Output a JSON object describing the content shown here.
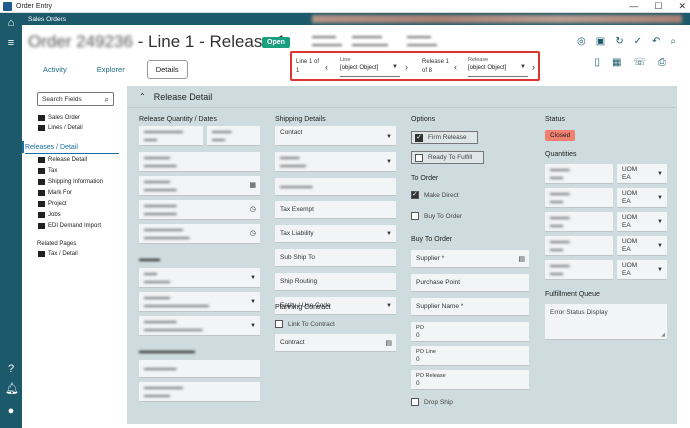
{
  "window": {
    "title": "Order Entry",
    "minimize": "—",
    "maximize": "☐",
    "close": "✕"
  },
  "breadcrumb": "Sales Orders",
  "header": {
    "order_label": "Order",
    "order_number": "249236",
    "line_release": " - Line 1 - Release 1",
    "status": "Open"
  },
  "tabs": [
    {
      "label": "Activity"
    },
    {
      "label": "Explorer"
    },
    {
      "label": "Details"
    }
  ],
  "nav": {
    "line_of_prefix": "Line 1 of",
    "line_of_count": "1",
    "line_caption": "Line",
    "line_value": "[object Object]",
    "release_of_prefix": "Release 1",
    "release_of_count": "of 8",
    "release_caption": "Release",
    "release_value": "[object Object]"
  },
  "sidebar": {
    "search_placeholder": "Search Fields",
    "items": [
      {
        "label": "Sales Order"
      },
      {
        "label": "Lines / Detail"
      }
    ],
    "section": "Releases / Detail",
    "sub_items": [
      {
        "label": "Release Detail"
      },
      {
        "label": "Tax"
      },
      {
        "label": "Shipping Information"
      },
      {
        "label": "Mark For"
      },
      {
        "label": "Project"
      },
      {
        "label": "Jobs"
      },
      {
        "label": "EDI Demand Import"
      }
    ],
    "related_title": "Related Pages",
    "related_items": [
      {
        "label": "Tax / Detail"
      }
    ]
  },
  "panel": {
    "title": "Release Detail",
    "release_qty_title": "Release Quantity / Dates",
    "shipping_title": "Shipping Details",
    "shipping": {
      "contact": "Contact",
      "tax_exempt": "Tax Exempt",
      "tax_liability": "Tax Liability",
      "sub_ship_to": "Sub Ship To",
      "ship_routing": "Ship Routing",
      "entity_use_code": "Entity / Use Code"
    },
    "planning_title": "Planning Contract",
    "link_to_contract": "Link To Contract",
    "contract": "Contract",
    "options_title": "Options",
    "firm_release": "Firm Release",
    "ready_to_fulfill": "Ready To Fulfill",
    "to_order_title": "To Order",
    "make_direct": "Make Direct",
    "buy_to_order": "Buy To Order",
    "buy_to_order_title": "Buy To Order",
    "supplier": "Supplier *",
    "purchase_point": "Purchase Point",
    "supplier_name": "Supplier Name *",
    "po_label": "PO",
    "po_value": "0",
    "po_line_label": "PO Line",
    "po_line_value": "0",
    "po_release_label": "PO Release",
    "po_release_value": "0",
    "drop_ship": "Drop Ship",
    "status_title": "Status",
    "status_value": "Closed",
    "quantities_title": "Quantities",
    "uom_label": "UOM",
    "uom_value": "EA",
    "fulfillment_title": "Fulfillment Queue",
    "error_status_display": "Error Status Display"
  },
  "colors": {
    "rail": "#1c5a6b",
    "open_badge": "#1aa07f",
    "closed_badge": "#f08070",
    "highlight": "#dd3333"
  }
}
